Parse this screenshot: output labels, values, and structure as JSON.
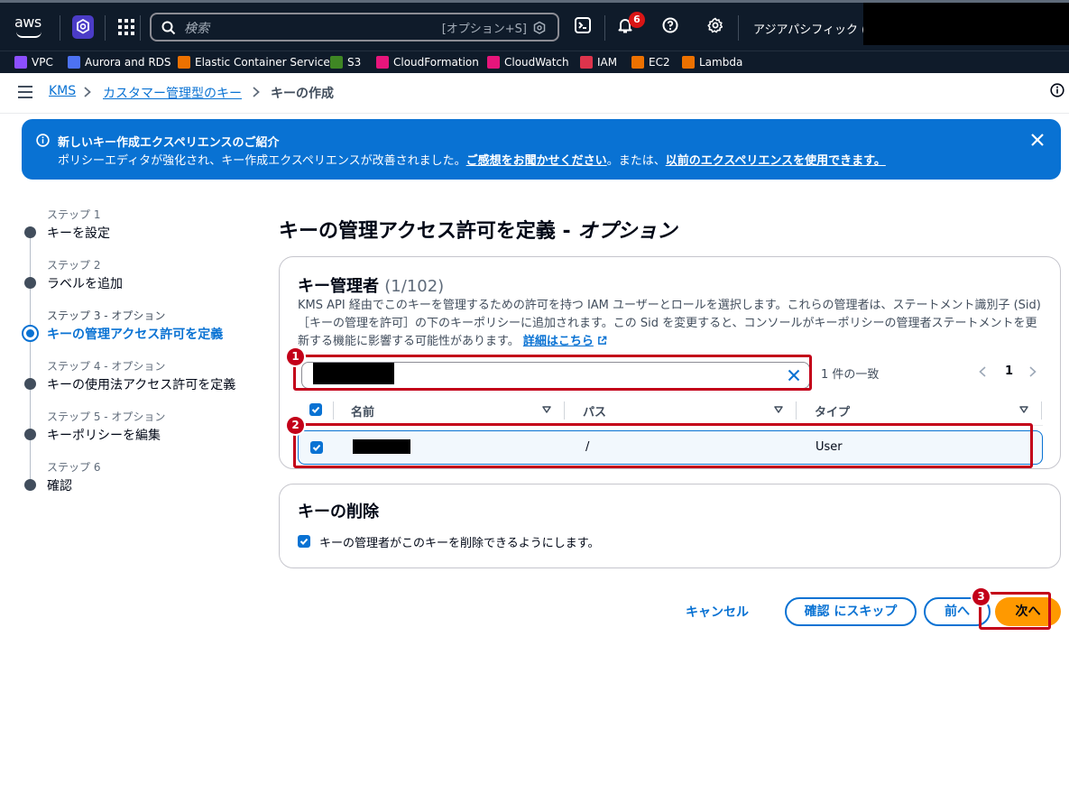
{
  "topnav": {
    "logo_text": "aws",
    "search_placeholder": "検索",
    "search_shortcut": "[オプション+S]",
    "notification_count": "6",
    "region": "アジアパシフィック (東"
  },
  "favorites": [
    {
      "label": "VPC",
      "color": "#8c4fff"
    },
    {
      "label": "Aurora and RDS",
      "color": "#4d72f3"
    },
    {
      "label": "Elastic Container Service",
      "color": "#ed7100"
    },
    {
      "label": "S3",
      "color": "#3f8624"
    },
    {
      "label": "CloudFormation",
      "color": "#e7157b"
    },
    {
      "label": "CloudWatch",
      "color": "#e7157b"
    },
    {
      "label": "IAM",
      "color": "#dd344c"
    },
    {
      "label": "EC2",
      "color": "#ed7100"
    },
    {
      "label": "Lambda",
      "color": "#ed7100"
    }
  ],
  "breadcrumb": {
    "items": [
      "KMS",
      "カスタマー管理型のキー",
      "キーの作成"
    ]
  },
  "flash": {
    "title": "新しいキー作成エクスペリエンスのご紹介",
    "text_before": "ポリシーエディタが強化され、キー作成エクスペリエンスが改善されました。",
    "feedback_link": "ご感想をお聞かせください",
    "text_middle": "。または、",
    "legacy_link": "以前のエクスペリエンスを使用できます。"
  },
  "steps": [
    {
      "small": "ステップ 1",
      "label": "キーを設定"
    },
    {
      "small": "ステップ 2",
      "label": "ラベルを追加"
    },
    {
      "small": "ステップ 3 - オプション",
      "label": "キーの管理アクセス許可を定義"
    },
    {
      "small": "ステップ 4 - オプション",
      "label": "キーの使用法アクセス許可を定義"
    },
    {
      "small": "ステップ 5 - オプション",
      "label": "キーポリシーを編集"
    },
    {
      "small": "ステップ 6",
      "label": "確認"
    }
  ],
  "page": {
    "title": "キーの管理アクセス許可を定義 - ",
    "title_optional": "オプション"
  },
  "admins": {
    "title": "キー管理者",
    "count": "(1/102)",
    "description": "KMS API 経由でこのキーを管理するための許可を持つ IAM ユーザーとロールを選択します。これらの管理者は、ステートメント識別子 (Sid)［キーの管理を許可］の下のキーポリシーに追加されます。この Sid を変更すると、コンソールがキーポリシーの管理者ステートメントを更新する機能に影響する可能性があります。",
    "learn_more": "詳細はこちら",
    "match_text": "1 件の一致",
    "page_number": "1",
    "columns": [
      "名前",
      "パス",
      "タイプ"
    ],
    "rows": [
      {
        "path": "/",
        "type": "User"
      }
    ]
  },
  "deletion": {
    "title": "キーの削除",
    "checkbox_label": "キーの管理者がこのキーを削除できるようにします。"
  },
  "footer": {
    "cancel": "キャンセル",
    "skip": "確認 にスキップ",
    "prev": "前へ",
    "next": "次へ"
  },
  "annotations": [
    "1",
    "2",
    "3"
  ]
}
